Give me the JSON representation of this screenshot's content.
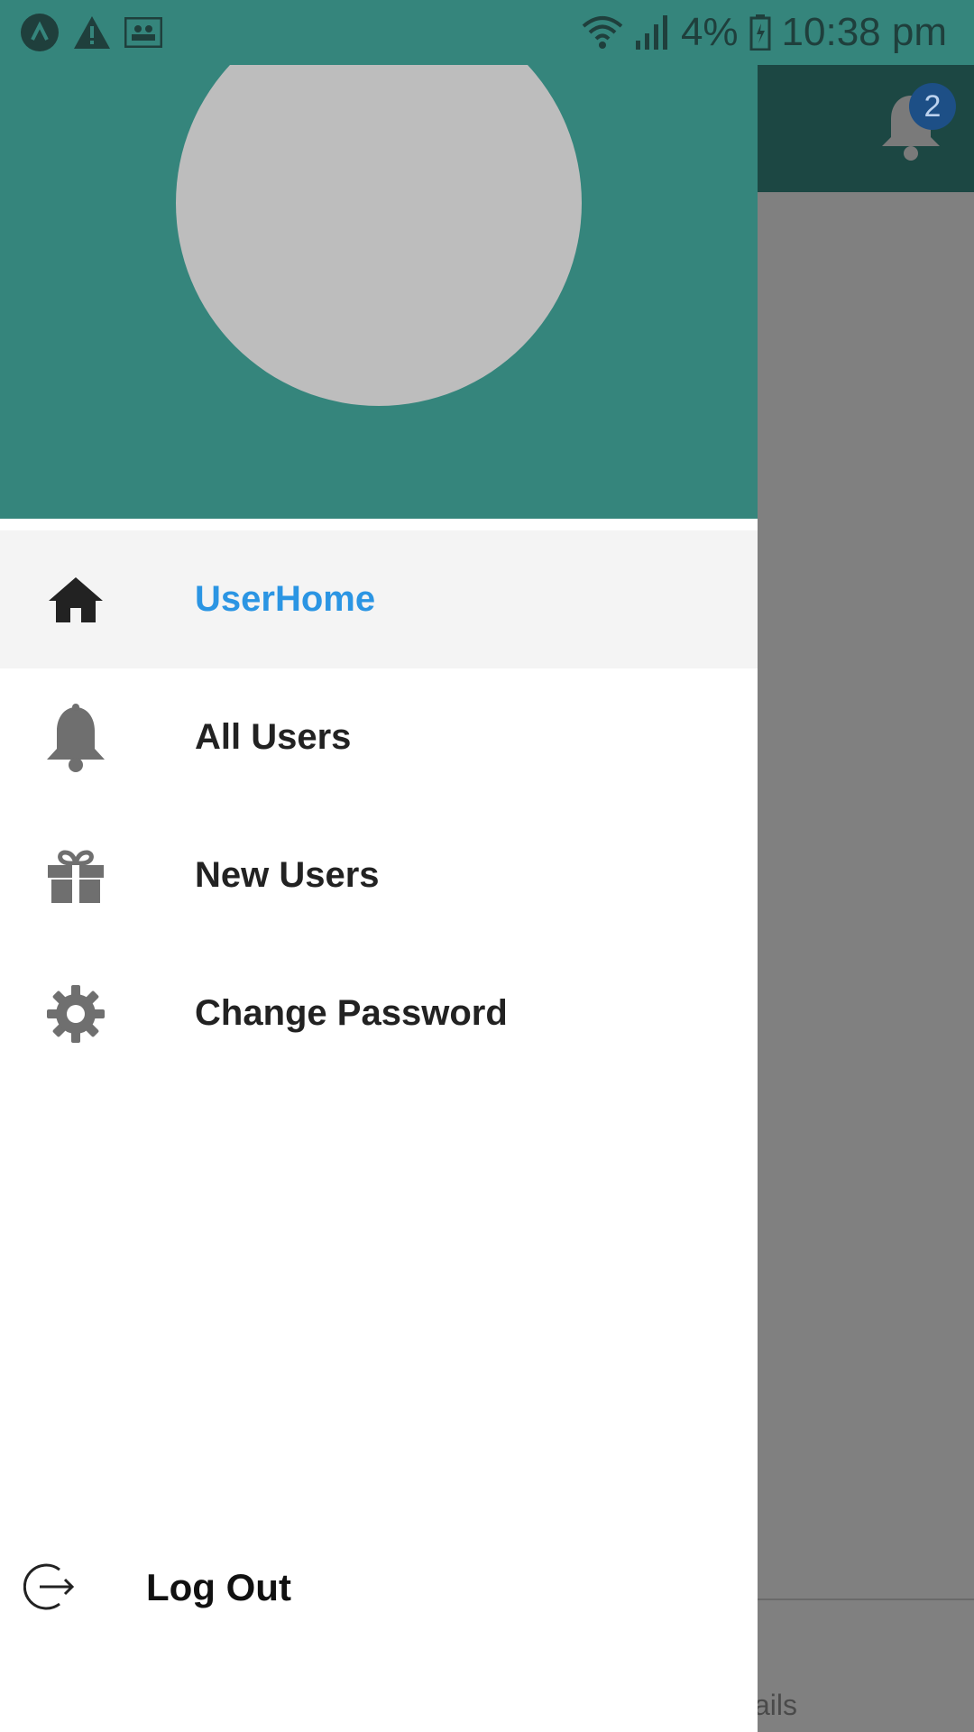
{
  "status_bar": {
    "battery": "4%",
    "time": "10:38 pm"
  },
  "app": {
    "notification_count": "2",
    "bottom_text": "ails"
  },
  "drawer": {
    "menu_items": [
      {
        "label": "UserHome",
        "icon": "home-icon",
        "active": true
      },
      {
        "label": "All Users",
        "icon": "bell-icon",
        "active": false
      },
      {
        "label": "New Users",
        "icon": "gift-icon",
        "active": false
      },
      {
        "label": "Change Password",
        "icon": "gear-icon",
        "active": false
      }
    ],
    "logout_label": "Log Out"
  },
  "colors": {
    "header": "#35857c",
    "toolbar": "#1c4743",
    "active_label": "#2b95e3",
    "scrim": "#808080"
  }
}
